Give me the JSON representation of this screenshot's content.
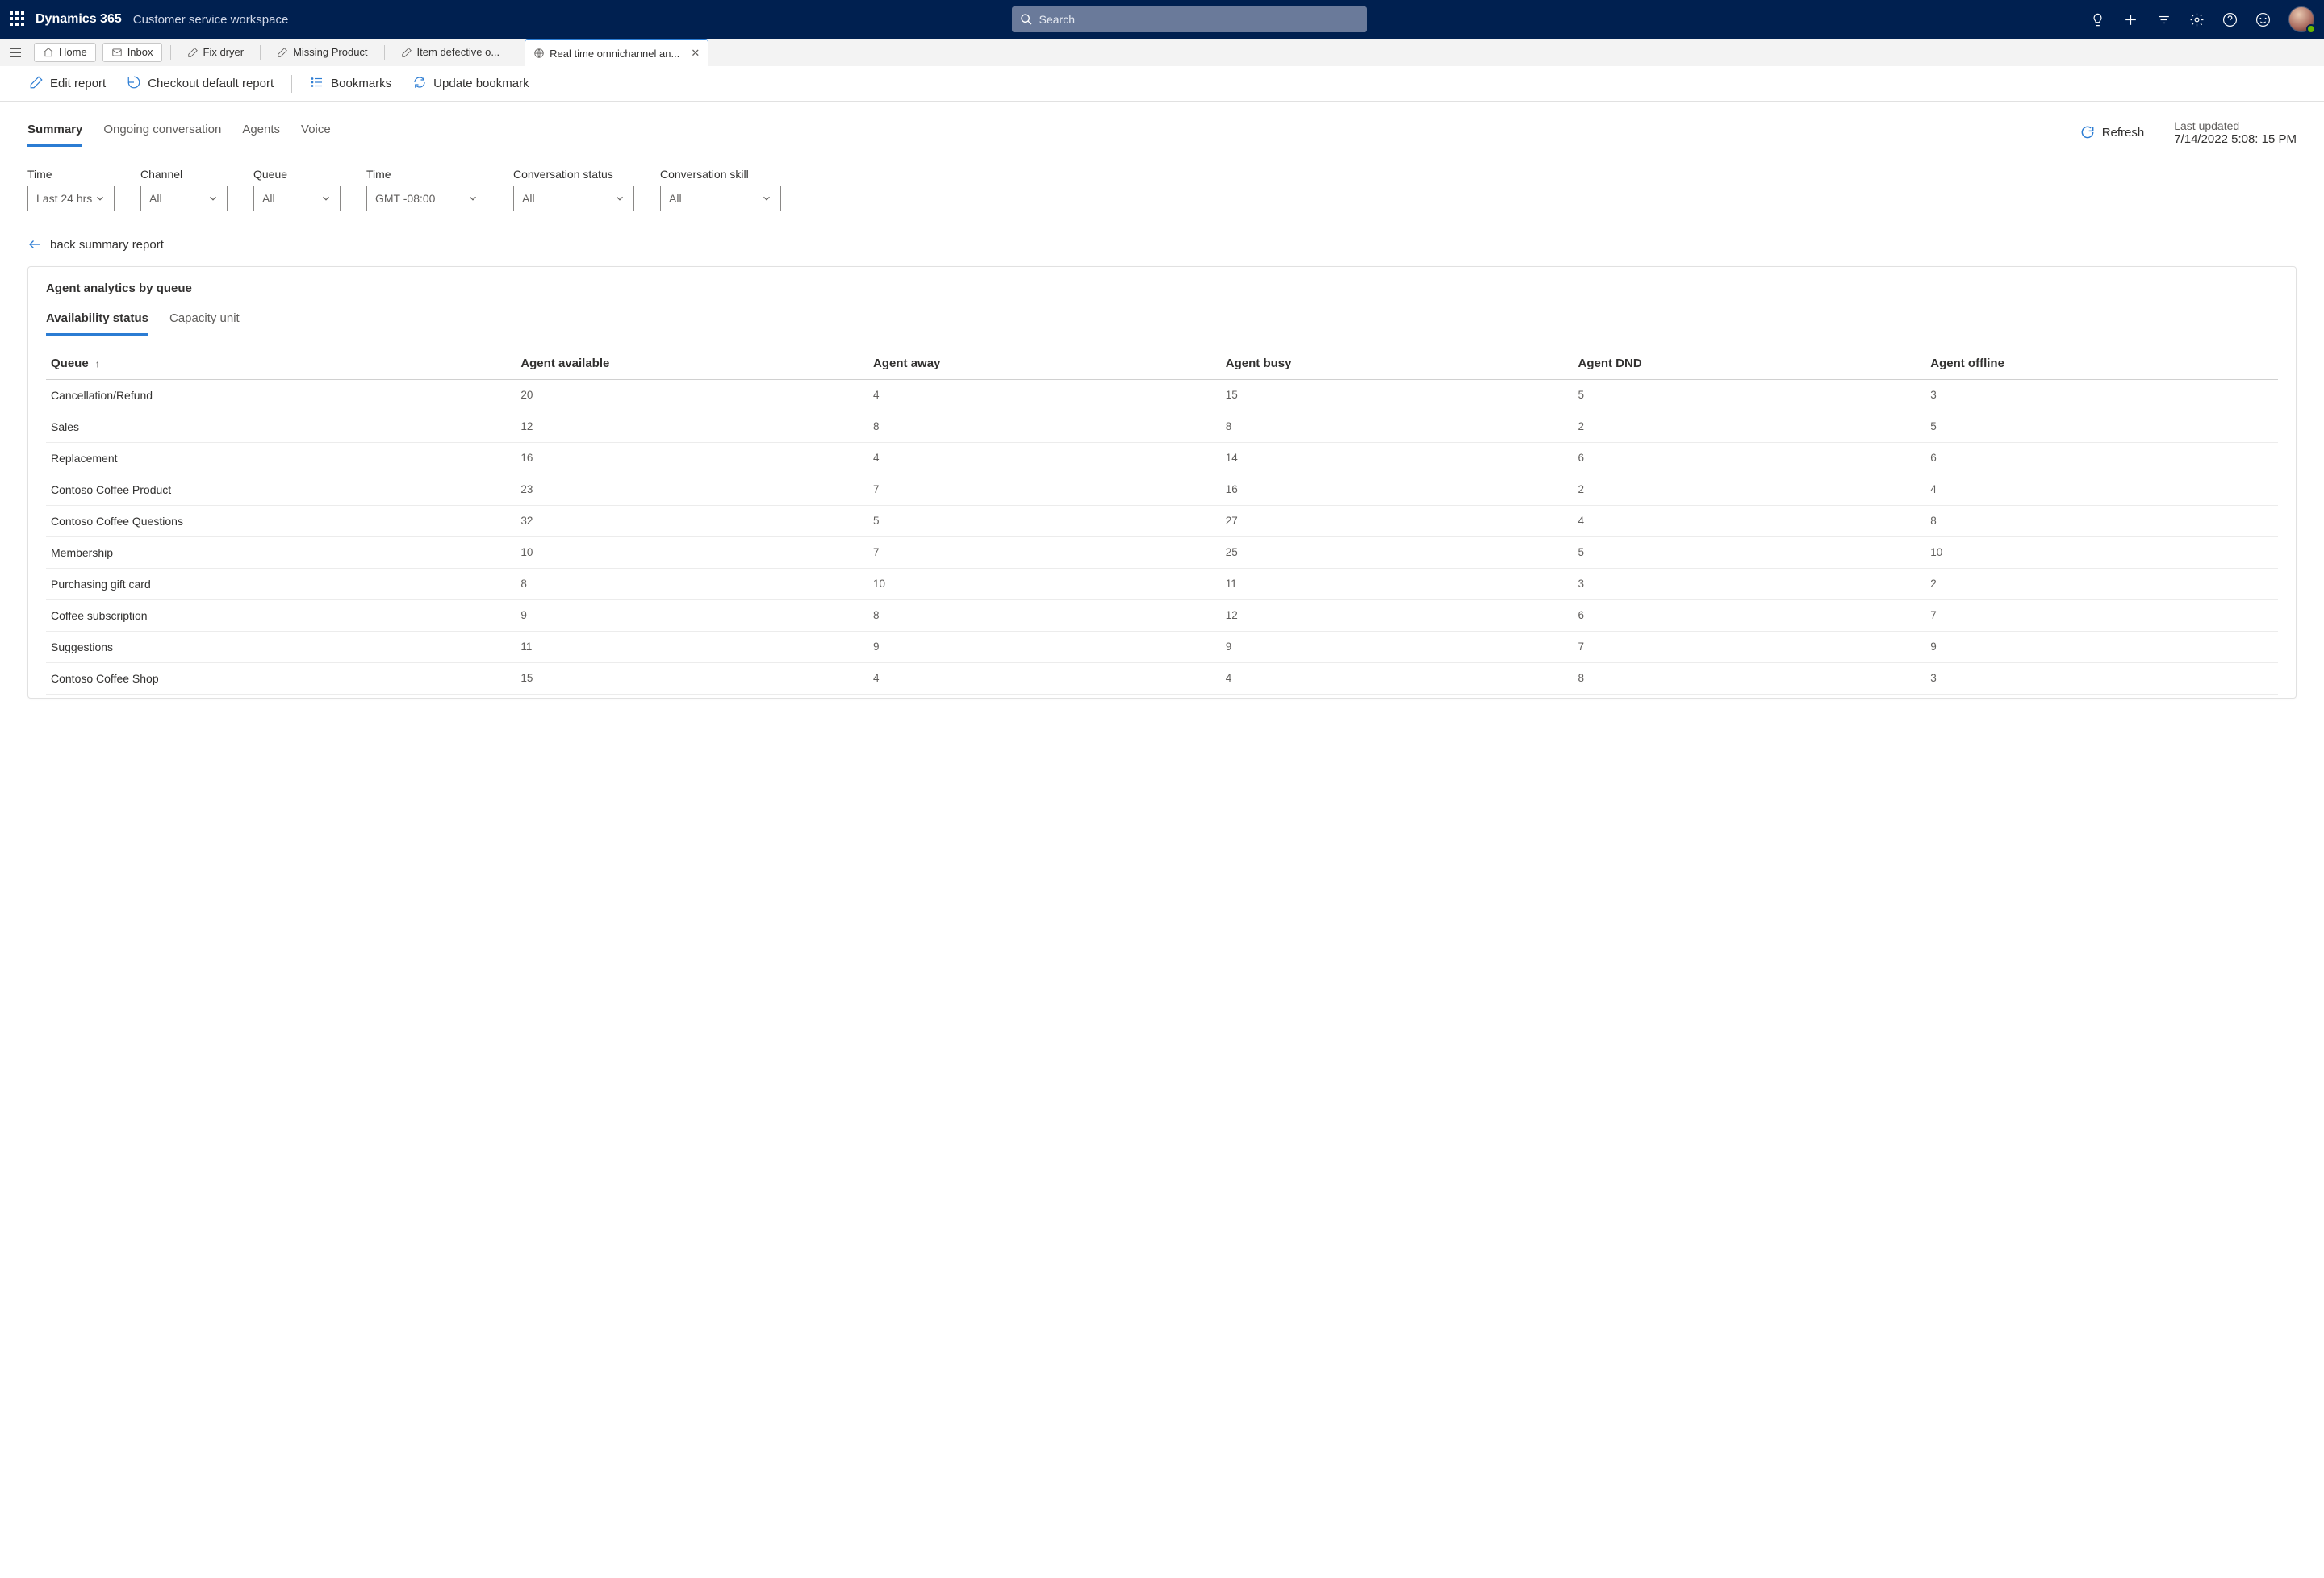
{
  "header": {
    "brand": "Dynamics 365",
    "workspace": "Customer service workspace",
    "search_placeholder": "Search"
  },
  "tab_pills": {
    "home": "Home",
    "inbox": "Inbox"
  },
  "case_tabs": [
    {
      "label": "Fix dryer",
      "active": false
    },
    {
      "label": "Missing Product",
      "active": false
    },
    {
      "label": "Item defective o...",
      "active": false
    },
    {
      "label": "Real time omnichannel an...",
      "active": true
    }
  ],
  "toolbar": {
    "edit_report": "Edit report",
    "checkout_default": "Checkout default report",
    "bookmarks": "Bookmarks",
    "update_bookmark": "Update bookmark"
  },
  "subnav": {
    "tabs": [
      "Summary",
      "Ongoing conversation",
      "Agents",
      "Voice"
    ],
    "active_index": 0,
    "refresh": "Refresh",
    "last_updated_label": "Last updated",
    "last_updated_value": "7/14/2022 5:08: 15 PM"
  },
  "filters": [
    {
      "label": "Time",
      "value": "Last 24 hrs"
    },
    {
      "label": "Channel",
      "value": "All"
    },
    {
      "label": "Queue",
      "value": "All"
    },
    {
      "label": "Time",
      "value": "GMT -08:00",
      "wide": true
    },
    {
      "label": "Conversation status",
      "value": "All",
      "wide": true
    },
    {
      "label": "Conversation skill",
      "value": "All",
      "wide": true
    }
  ],
  "back_link": "back summary report",
  "card": {
    "title": "Agent analytics by queue",
    "subtabs": [
      "Availability status",
      "Capacity unit"
    ],
    "active_subtab": 0
  },
  "table": {
    "columns": [
      "Queue",
      "Agent available",
      "Agent away",
      "Agent busy",
      "Agent DND",
      "Agent offline"
    ],
    "sort_col": 0,
    "rows": [
      [
        "Cancellation/Refund",
        "20",
        "4",
        "15",
        "5",
        "3"
      ],
      [
        "Sales",
        "12",
        "8",
        "8",
        "2",
        "5"
      ],
      [
        "Replacement",
        "16",
        "4",
        "14",
        "6",
        "6"
      ],
      [
        "Contoso Coffee Product",
        "23",
        "7",
        "16",
        "2",
        "4"
      ],
      [
        "Contoso Coffee Questions",
        "32",
        "5",
        "27",
        "4",
        "8"
      ],
      [
        "Membership",
        "10",
        "7",
        "25",
        "5",
        "10"
      ],
      [
        "Purchasing gift card",
        "8",
        "10",
        "11",
        "3",
        "2"
      ],
      [
        "Coffee subscription",
        "9",
        "8",
        "12",
        "6",
        "7"
      ],
      [
        "Suggestions",
        "11",
        "9",
        "9",
        "7",
        "9"
      ],
      [
        "Contoso Coffee Shop",
        "15",
        "4",
        "4",
        "8",
        "3"
      ]
    ]
  }
}
